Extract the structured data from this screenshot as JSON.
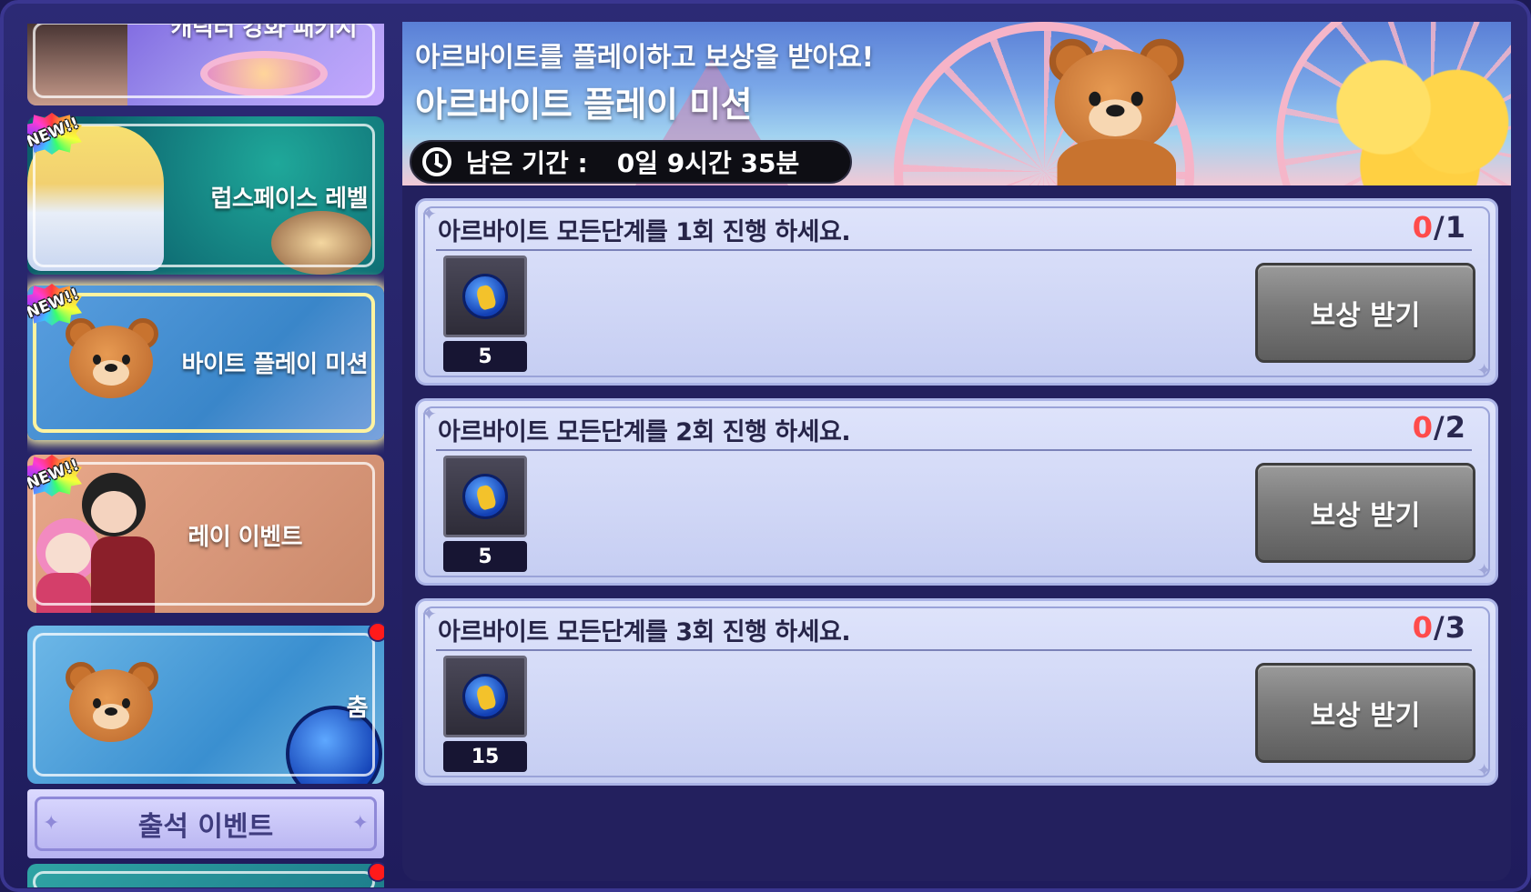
{
  "sidebar": {
    "items": [
      {
        "label": "캐릭터 강화 패키지",
        "new": false
      },
      {
        "label": "럽스페이스 레벨",
        "new": true
      },
      {
        "label": "바이트 플레이 미션",
        "new": true,
        "selected": true
      },
      {
        "label": "레이 이벤트",
        "new": true
      },
      {
        "label": "춤",
        "new": false,
        "notification": true
      }
    ],
    "new_badge": "NEW!!",
    "attendance_label": "출석 이벤트"
  },
  "banner": {
    "subtitle": "아르바이트를 플레이하고 보상을 받아요!",
    "title": "아르바이트 플레이 미션",
    "timer_label": "남은 기간 :",
    "timer_value": "0일 9시간 35분"
  },
  "missions": [
    {
      "description": "아르바이트 모든단계를 1회 진행 하세요.",
      "current": "0",
      "separator": "/",
      "target": "1",
      "reward_qty": "5",
      "button": "보상 받기"
    },
    {
      "description": "아르바이트 모든단계를 2회 진행 하세요.",
      "current": "0",
      "separator": "/",
      "target": "2",
      "reward_qty": "5",
      "button": "보상 받기"
    },
    {
      "description": "아르바이트 모든단계를 3회 진행 하세요.",
      "current": "0",
      "separator": "/",
      "target": "3",
      "reward_qty": "15",
      "button": "보상 받기"
    }
  ],
  "colors": {
    "progress_current": "#ff4b4b",
    "panel_bg": "#23205e",
    "claim_button": "#7a7a7a"
  }
}
